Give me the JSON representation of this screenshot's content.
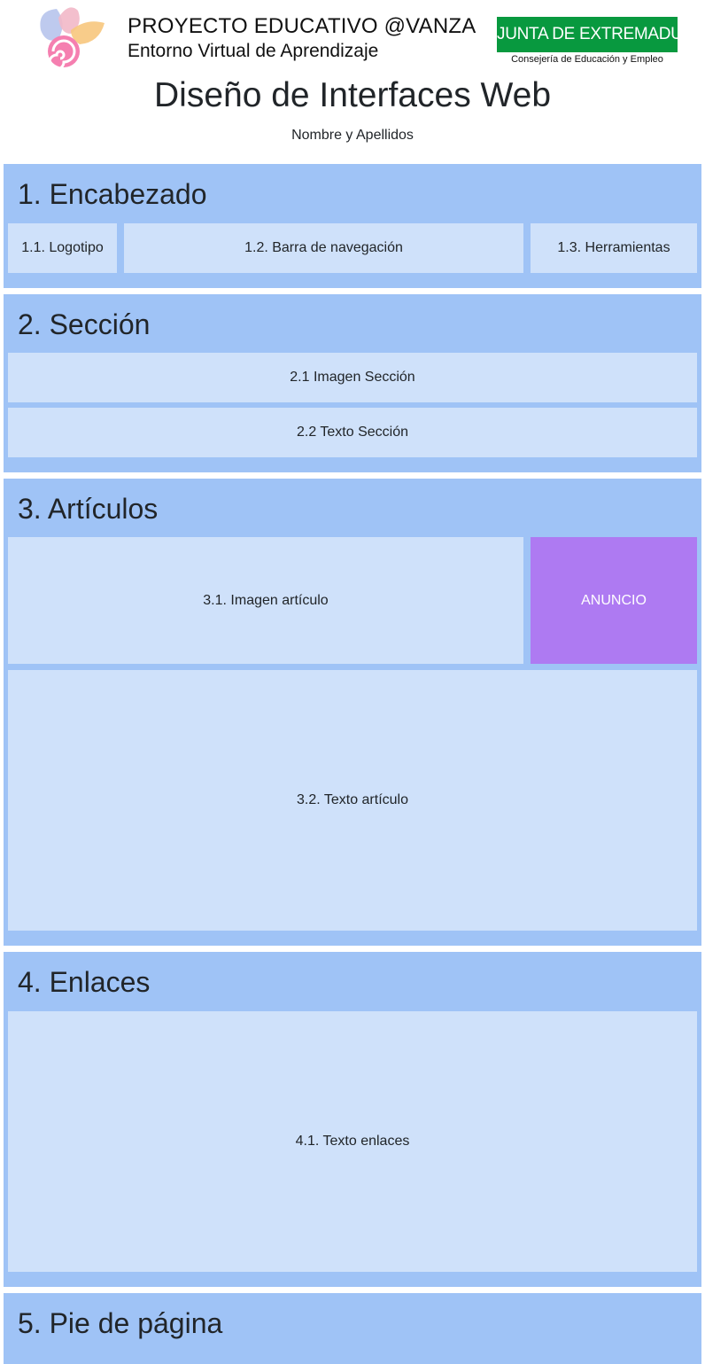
{
  "banner": {
    "title": "PROYECTO EDUCATIVO @VANZA",
    "subtitle": "Entorno Virtual de Aprendizaje",
    "junta_title": "JUNTA DE EXTREMADURA",
    "junta_subtitle": "Consejería de Educación y Empleo"
  },
  "page": {
    "title": "Diseño de Interfaces Web",
    "author": "Nombre y Apellidos"
  },
  "colors": {
    "section_bg": "#9fc3f6",
    "box_bg": "#cfe1fa",
    "ad_bg": "#ae7af2",
    "junta_green": "#08993f"
  },
  "sections": {
    "header": {
      "title": "1. Encabezado",
      "logo": "1.1. Logotipo",
      "nav": "1.2. Barra de navegación",
      "tools": "1.3. Herramientas"
    },
    "section": {
      "title": "2. Sección",
      "image": "2.1 Imagen Sección",
      "text": "2.2 Texto Sección"
    },
    "articles": {
      "title": "3. Artículos",
      "image": "3.1. Imagen artículo",
      "ad": "ANUNCIO",
      "text": "3.2. Texto artículo"
    },
    "links": {
      "title": "4. Enlaces",
      "text": "4.1. Texto enlaces"
    },
    "footer": {
      "title": "5. Pie de página"
    }
  }
}
